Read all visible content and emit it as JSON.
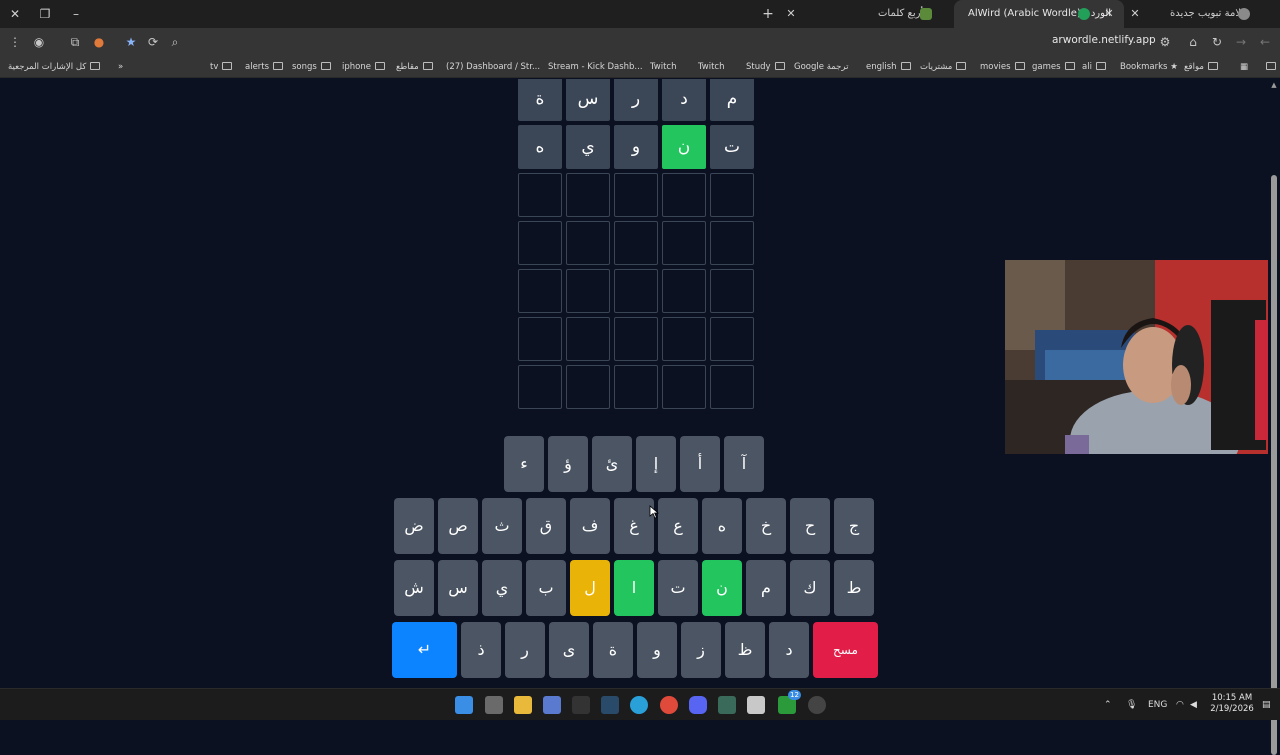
{
  "browser": {
    "tabs": [
      {
        "title": "علامة تبويب جديدة",
        "active": false
      },
      {
        "title": "AlWird (Arabic Wordle) - الورد",
        "active": true
      },
      {
        "title": "أربع كلمات",
        "active": false
      }
    ],
    "url": "arwordle.netlify.app",
    "bookmarks": [
      "مواقع",
      "Bookmarks",
      "ali",
      "games",
      "movies",
      "مشتريات",
      "english",
      "Google ترجمة",
      "Study",
      "Twitch",
      "Twitch",
      "Stream - Kick Dashb...",
      "(27) Dashboard / Str...",
      "مقاطع",
      "iphone",
      "songs",
      "alerts",
      "tv",
      "كل الإشارات المرجعية"
    ]
  },
  "board": {
    "rows": [
      {
        "letters": [
          "م",
          "د",
          "ر",
          "س",
          "ة"
        ],
        "states": [
          "filled",
          "filled",
          "filled",
          "filled",
          "filled"
        ]
      },
      {
        "letters": [
          "ت",
          "ن",
          "و",
          "ي",
          "ه"
        ],
        "states": [
          "filled",
          "green",
          "filled",
          "filled",
          "filled"
        ]
      },
      {
        "letters": [
          "",
          "",
          "",
          "",
          ""
        ],
        "states": [
          "empty",
          "empty",
          "empty",
          "empty",
          "empty"
        ]
      },
      {
        "letters": [
          "",
          "",
          "",
          "",
          ""
        ],
        "states": [
          "empty",
          "empty",
          "empty",
          "empty",
          "empty"
        ]
      },
      {
        "letters": [
          "",
          "",
          "",
          "",
          ""
        ],
        "states": [
          "empty",
          "empty",
          "empty",
          "empty",
          "empty"
        ]
      },
      {
        "letters": [
          "",
          "",
          "",
          "",
          ""
        ],
        "states": [
          "empty",
          "empty",
          "empty",
          "empty",
          "empty"
        ]
      },
      {
        "letters": [
          "",
          "",
          "",
          "",
          ""
        ],
        "states": [
          "empty",
          "empty",
          "empty",
          "empty",
          "empty"
        ]
      }
    ]
  },
  "keyboard": {
    "row1": [
      {
        "label": "آ",
        "state": "default"
      },
      {
        "label": "أ",
        "state": "default"
      },
      {
        "label": "إ",
        "state": "default"
      },
      {
        "label": "ئ",
        "state": "default"
      },
      {
        "label": "ؤ",
        "state": "default"
      },
      {
        "label": "ء",
        "state": "default"
      }
    ],
    "row2": [
      {
        "label": "ج",
        "state": "default"
      },
      {
        "label": "ح",
        "state": "default"
      },
      {
        "label": "خ",
        "state": "default"
      },
      {
        "label": "ه",
        "state": "default"
      },
      {
        "label": "ع",
        "state": "default"
      },
      {
        "label": "غ",
        "state": "default"
      },
      {
        "label": "ف",
        "state": "default"
      },
      {
        "label": "ق",
        "state": "default"
      },
      {
        "label": "ث",
        "state": "default"
      },
      {
        "label": "ص",
        "state": "default"
      },
      {
        "label": "ض",
        "state": "default"
      }
    ],
    "row3": [
      {
        "label": "ط",
        "state": "default"
      },
      {
        "label": "ك",
        "state": "default"
      },
      {
        "label": "م",
        "state": "default"
      },
      {
        "label": "ن",
        "state": "green"
      },
      {
        "label": "ت",
        "state": "default"
      },
      {
        "label": "ا",
        "state": "green"
      },
      {
        "label": "ل",
        "state": "yellow"
      },
      {
        "label": "ب",
        "state": "default"
      },
      {
        "label": "ي",
        "state": "default"
      },
      {
        "label": "س",
        "state": "default"
      },
      {
        "label": "ش",
        "state": "default"
      }
    ],
    "row4": [
      {
        "label": "مسح",
        "state": "delete"
      },
      {
        "label": "د",
        "state": "default"
      },
      {
        "label": "ظ",
        "state": "default"
      },
      {
        "label": "ز",
        "state": "default"
      },
      {
        "label": "و",
        "state": "default"
      },
      {
        "label": "ة",
        "state": "default"
      },
      {
        "label": "ى",
        "state": "default"
      },
      {
        "label": "ر",
        "state": "default"
      },
      {
        "label": "ذ",
        "state": "default"
      },
      {
        "label": "↵",
        "state": "enter"
      }
    ]
  },
  "taskbar": {
    "language": "ENG",
    "time": "10:15 AM",
    "date": "2/19/2026",
    "badge": "12"
  },
  "colors": {
    "background": "#0b1120",
    "correct": "#22c55e",
    "present": "#eab308",
    "key": "#4b5563",
    "enter": "#0d84ff",
    "delete": "#e11d48"
  }
}
